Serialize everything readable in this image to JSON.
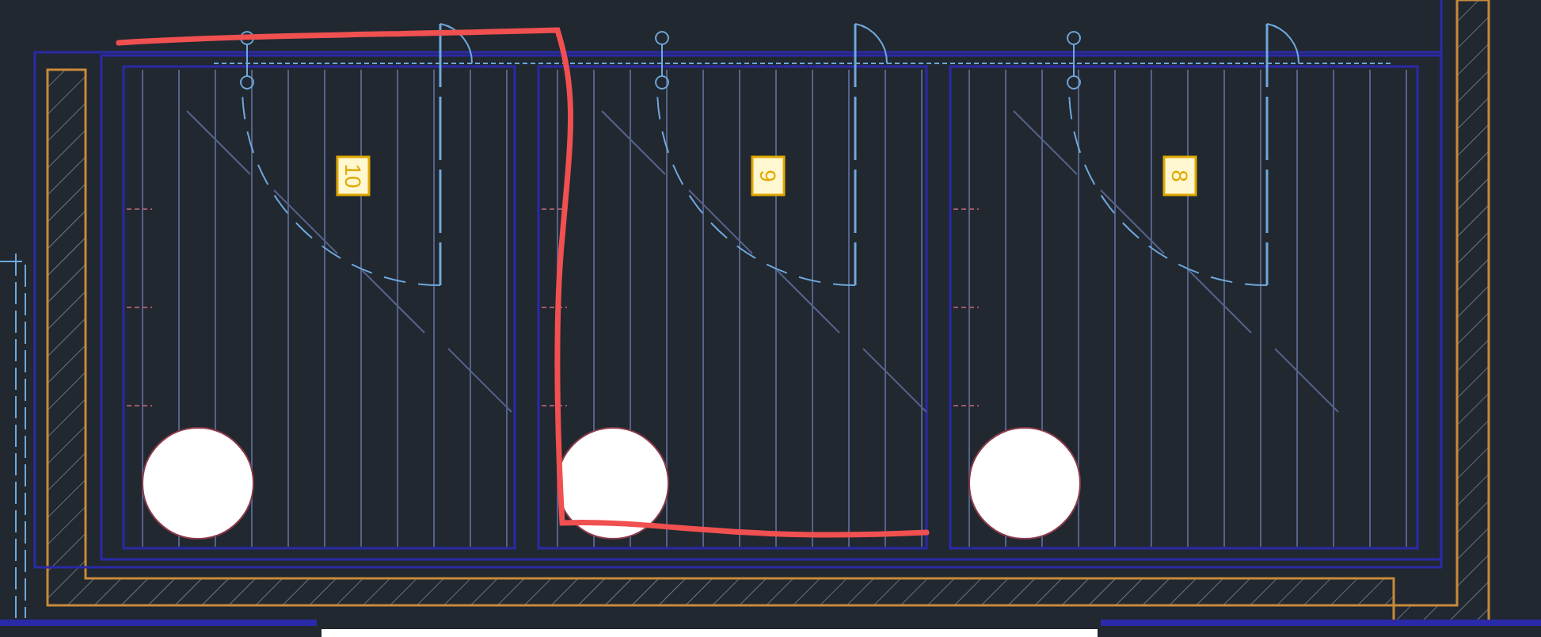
{
  "stalls": [
    {
      "number": "10"
    },
    {
      "number": "9"
    },
    {
      "number": "8"
    }
  ]
}
